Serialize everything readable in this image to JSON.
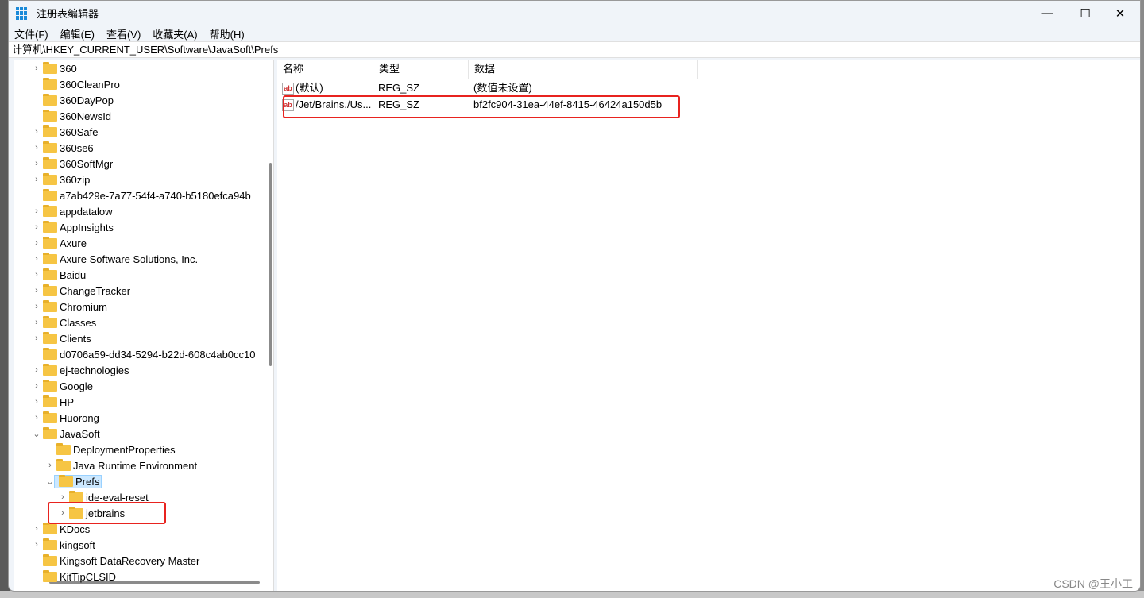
{
  "window": {
    "title": "注册表编辑器",
    "minimize": "—",
    "maximize": "☐",
    "close": "✕"
  },
  "menu": [
    "文件(F)",
    "编辑(E)",
    "查看(V)",
    "收藏夹(A)",
    "帮助(H)"
  ],
  "address": "计算机\\HKEY_CURRENT_USER\\Software\\JavaSoft\\Prefs",
  "tree": [
    {
      "label": "360",
      "level": 1,
      "chevron": ">"
    },
    {
      "label": "360CleanPro",
      "level": 1,
      "chevron": ""
    },
    {
      "label": "360DayPop",
      "level": 1,
      "chevron": ""
    },
    {
      "label": "360NewsId",
      "level": 1,
      "chevron": ""
    },
    {
      "label": "360Safe",
      "level": 1,
      "chevron": ">"
    },
    {
      "label": "360se6",
      "level": 1,
      "chevron": ">"
    },
    {
      "label": "360SoftMgr",
      "level": 1,
      "chevron": ">"
    },
    {
      "label": "360zip",
      "level": 1,
      "chevron": ">"
    },
    {
      "label": "a7ab429e-7a77-54f4-a740-b5180efca94b",
      "level": 1,
      "chevron": ""
    },
    {
      "label": "appdatalow",
      "level": 1,
      "chevron": ">"
    },
    {
      "label": "AppInsights",
      "level": 1,
      "chevron": ">"
    },
    {
      "label": "Axure",
      "level": 1,
      "chevron": ">"
    },
    {
      "label": "Axure Software Solutions, Inc.",
      "level": 1,
      "chevron": ">"
    },
    {
      "label": "Baidu",
      "level": 1,
      "chevron": ">"
    },
    {
      "label": "ChangeTracker",
      "level": 1,
      "chevron": ">"
    },
    {
      "label": "Chromium",
      "level": 1,
      "chevron": ">"
    },
    {
      "label": "Classes",
      "level": 1,
      "chevron": ">"
    },
    {
      "label": "Clients",
      "level": 1,
      "chevron": ">"
    },
    {
      "label": "d0706a59-dd34-5294-b22d-608c4ab0cc10",
      "level": 1,
      "chevron": ""
    },
    {
      "label": "ej-technologies",
      "level": 1,
      "chevron": ">"
    },
    {
      "label": "Google",
      "level": 1,
      "chevron": ">"
    },
    {
      "label": "HP",
      "level": 1,
      "chevron": ">"
    },
    {
      "label": "Huorong",
      "level": 1,
      "chevron": ">"
    },
    {
      "label": "JavaSoft",
      "level": 1,
      "chevron": "v"
    },
    {
      "label": "DeploymentProperties",
      "level": 2,
      "chevron": ""
    },
    {
      "label": "Java Runtime Environment",
      "level": 2,
      "chevron": ">"
    },
    {
      "label": "Prefs",
      "level": 2,
      "chevron": "v",
      "selected": true
    },
    {
      "label": "ide-eval-reset",
      "level": 3,
      "chevron": ">"
    },
    {
      "label": "jetbrains",
      "level": 3,
      "chevron": ">",
      "highlighted": true
    },
    {
      "label": "KDocs",
      "level": 1,
      "chevron": ">"
    },
    {
      "label": "kingsoft",
      "level": 1,
      "chevron": ">"
    },
    {
      "label": "Kingsoft DataRecovery Master",
      "level": 1,
      "chevron": ""
    },
    {
      "label": "KitTipCLSID",
      "level": 1,
      "chevron": ""
    }
  ],
  "values": {
    "headers": [
      "名称",
      "类型",
      "数据"
    ],
    "rows": [
      {
        "name": "(默认)",
        "type": "REG_SZ",
        "data": "(数值未设置)"
      },
      {
        "name": "/Jet/Brains./Us...",
        "type": "REG_SZ",
        "data": "bf2fc904-31ea-44ef-8415-46424a150d5b",
        "highlighted": true
      }
    ]
  },
  "icon_label": "ab",
  "watermark": "CSDN @王小工",
  "colors": {
    "highlight": "#e8231f",
    "selection": "#cce8ff",
    "folder": "#f6c544"
  }
}
